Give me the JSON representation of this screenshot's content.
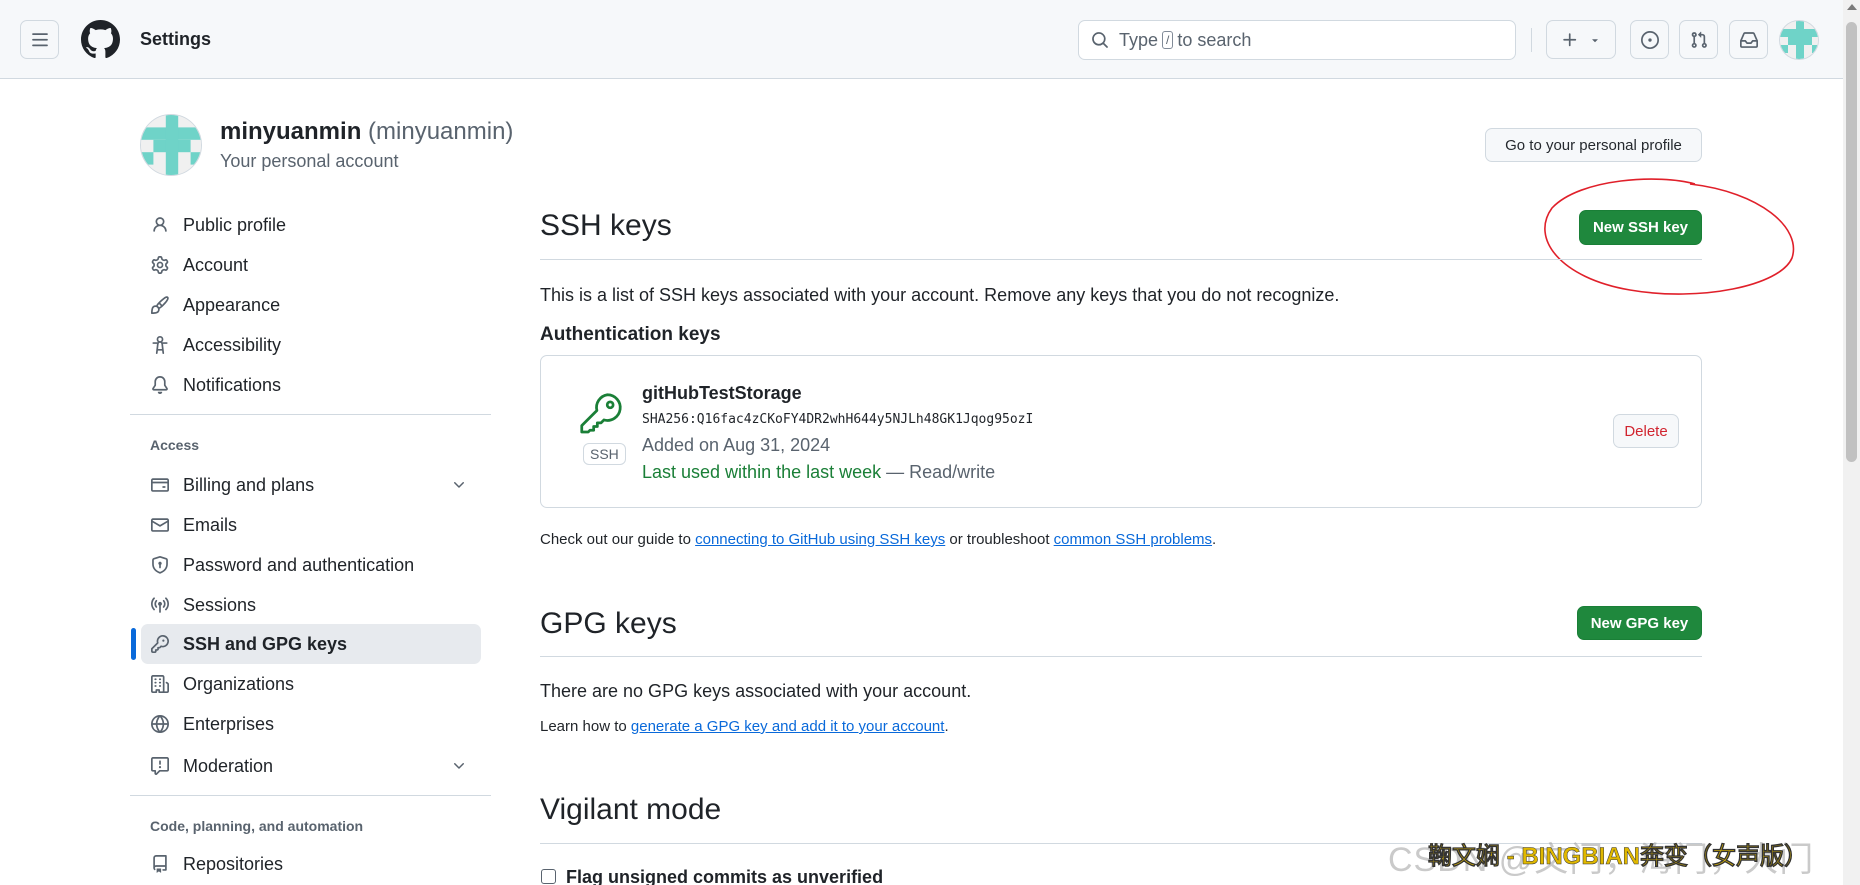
{
  "header": {
    "title": "Settings",
    "search_prefix": "Type",
    "search_key": "/",
    "search_suffix": "to search"
  },
  "profile": {
    "name": "minyuanmin",
    "login": "(minyuanmin)",
    "subtitle": "Your personal account",
    "button_label": "Go to your personal profile"
  },
  "sidebar": {
    "items": [
      {
        "label": "Public profile",
        "icon": "person-icon"
      },
      {
        "label": "Account",
        "icon": "gear-icon"
      },
      {
        "label": "Appearance",
        "icon": "paintbrush-icon"
      },
      {
        "label": "Accessibility",
        "icon": "accessibility-icon"
      },
      {
        "label": "Notifications",
        "icon": "bell-icon"
      }
    ],
    "access_heading": "Access",
    "access_items": [
      {
        "label": "Billing and plans",
        "icon": "credit-card-icon"
      },
      {
        "label": "Emails",
        "icon": "mail-icon"
      },
      {
        "label": "Password and authentication",
        "icon": "shield-lock-icon"
      },
      {
        "label": "Sessions",
        "icon": "broadcast-icon"
      },
      {
        "label": "SSH and GPG keys",
        "icon": "key-icon"
      },
      {
        "label": "Organizations",
        "icon": "organization-icon"
      },
      {
        "label": "Enterprises",
        "icon": "globe-icon"
      },
      {
        "label": "Moderation",
        "icon": "report-icon"
      }
    ],
    "code_heading": "Code, planning, and automation",
    "code_items": [
      {
        "label": "Repositories",
        "icon": "repo-icon"
      }
    ]
  },
  "ssh": {
    "title": "SSH keys",
    "new_button": "New SSH key",
    "description": "This is a list of SSH keys associated with your account. Remove any keys that you do not recognize.",
    "auth_heading": "Authentication keys",
    "key": {
      "name": "gitHubTestStorage",
      "fingerprint": "SHA256:Q16fac4zCKoFY4DR2whH644y5NJLh48GK1Jqog95ozI",
      "type_label": "SSH",
      "added": "Added on Aug 31, 2024",
      "last_used": "Last used within the last week",
      "access": " — Read/write",
      "delete_label": "Delete"
    },
    "guide_prefix": "Check out our guide to ",
    "guide_link1": "connecting to GitHub using SSH keys",
    "guide_mid": " or troubleshoot ",
    "guide_link2": "common SSH problems",
    "guide_suffix": "."
  },
  "gpg": {
    "title": "GPG keys",
    "new_button": "New GPG key",
    "empty_text": "There are no GPG keys associated with your account.",
    "learn_prefix": "Learn how to ",
    "learn_link": "generate a GPG key and add it to your account",
    "learn_suffix": "."
  },
  "vigilant": {
    "title": "Vigilant mode",
    "checkbox_label": "Flag unsigned commits as unverified"
  },
  "watermark": {
    "text": "CSDN @文门，海门，大门",
    "overlay": "鞠文娴 - BINGBIAN奔变（女声版）"
  },
  "colors": {
    "accent": "#0969da",
    "primary_button": "#1f883d",
    "danger": "#d1242f",
    "success_text": "#1a7f37",
    "annotation": "#e0202a"
  }
}
